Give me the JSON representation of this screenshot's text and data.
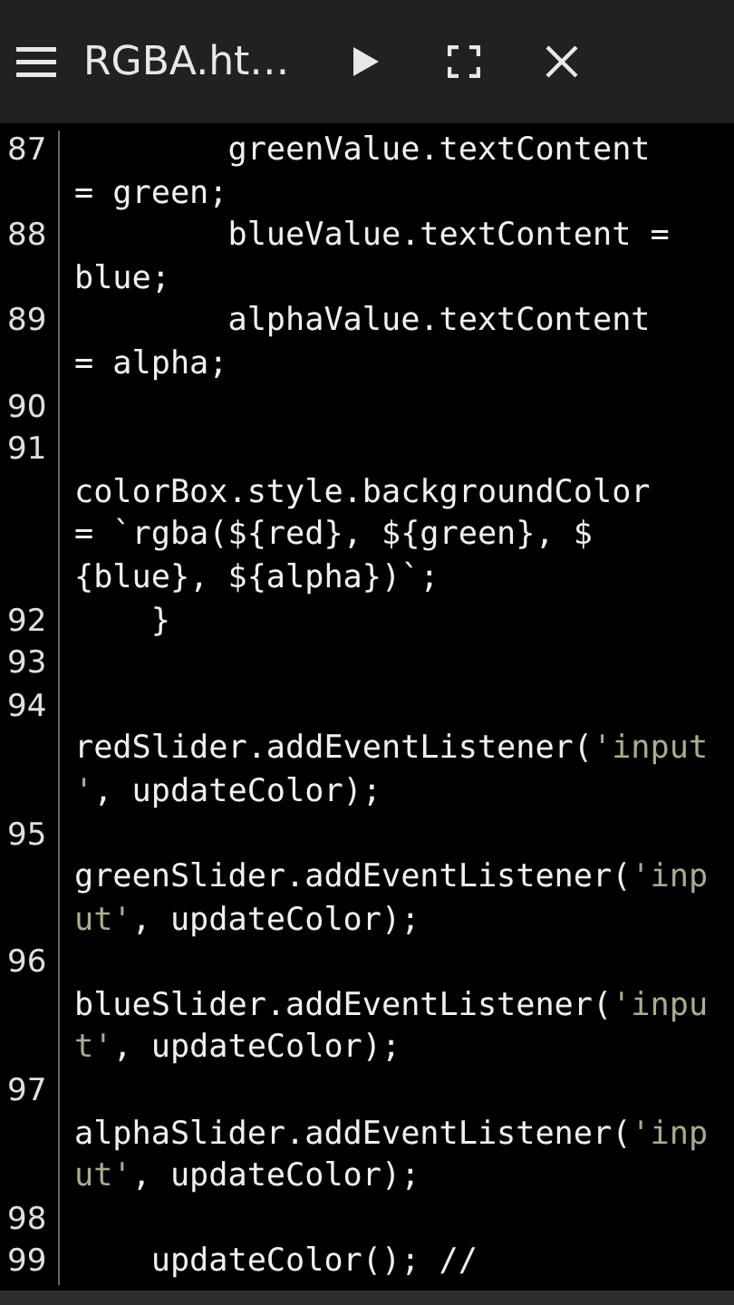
{
  "toolbar": {
    "title": "RGBA.ht…"
  },
  "lines": [
    {
      "number": "87",
      "rows": [
        {
          "kind": "code",
          "before": "        greenValue.textContent"
        },
        {
          "kind": "code",
          "before": "= green;"
        }
      ]
    },
    {
      "number": "88",
      "rows": [
        {
          "kind": "code",
          "before": "        blueValue.textContent ="
        },
        {
          "kind": "code",
          "before": "blue;"
        }
      ]
    },
    {
      "number": "89",
      "rows": [
        {
          "kind": "code",
          "before": "        alphaValue.textContent"
        },
        {
          "kind": "code",
          "before": "= alpha;"
        }
      ]
    },
    {
      "number": "90",
      "rows": [
        {
          "kind": "blank"
        }
      ]
    },
    {
      "number": "91",
      "rows": [
        {
          "kind": "blank"
        },
        {
          "kind": "code",
          "before": "colorBox.style.backgroundColor"
        },
        {
          "kind": "code",
          "before": "= `rgba(${red}, ${green}, $"
        },
        {
          "kind": "code",
          "before": "{blue}, ${alpha})`;"
        }
      ]
    },
    {
      "number": "92",
      "rows": [
        {
          "kind": "code",
          "before": "    }"
        }
      ]
    },
    {
      "number": "93",
      "rows": [
        {
          "kind": "blank"
        }
      ]
    },
    {
      "number": "94",
      "rows": [
        {
          "kind": "blank"
        },
        {
          "kind": "code",
          "before": "redSlider.addEventListener(",
          "literal": "'input"
        },
        {
          "kind": "code",
          "literal": "'",
          "after": ", updateColor);"
        }
      ]
    },
    {
      "number": "95",
      "rows": [
        {
          "kind": "blank"
        },
        {
          "kind": "code",
          "before": "greenSlider.addEventListener(",
          "literal": "'inp"
        },
        {
          "kind": "code",
          "literal": "ut'",
          "after": ", updateColor);"
        }
      ]
    },
    {
      "number": "96",
      "rows": [
        {
          "kind": "blank"
        },
        {
          "kind": "code",
          "before": "blueSlider.addEventListener(",
          "literal": "'inpu"
        },
        {
          "kind": "code",
          "literal": "t'",
          "after": ", updateColor);"
        }
      ]
    },
    {
      "number": "97",
      "rows": [
        {
          "kind": "blank"
        },
        {
          "kind": "code",
          "before": "alphaSlider.addEventListener(",
          "literal": "'inp"
        },
        {
          "kind": "code",
          "literal": "ut'",
          "after": ", updateColor);"
        }
      ]
    },
    {
      "number": "98",
      "rows": [
        {
          "kind": "blank"
        }
      ]
    },
    {
      "number": "99",
      "rows": [
        {
          "kind": "code",
          "before": "    updateColor(); //"
        }
      ]
    }
  ]
}
